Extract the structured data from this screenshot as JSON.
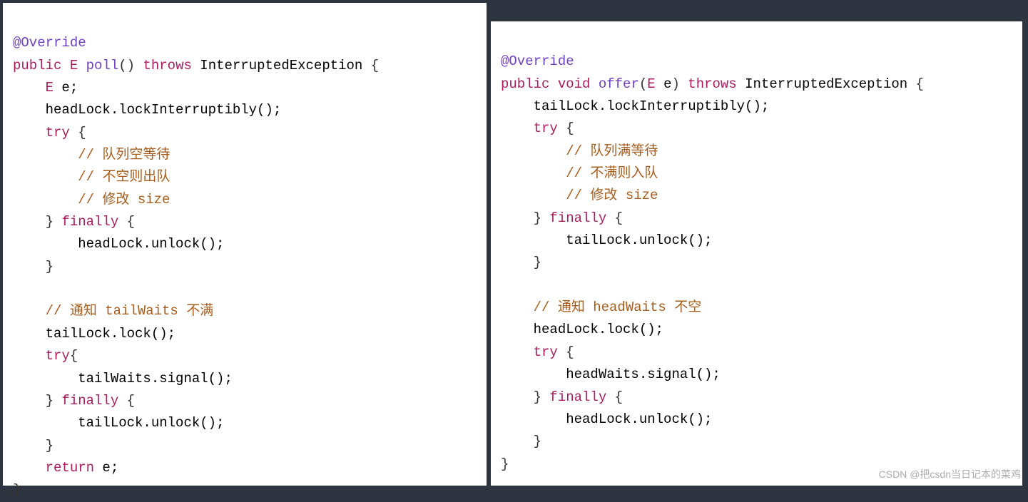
{
  "left": {
    "l1": "@Override",
    "l2_kw_public": "public",
    "l2_type_E": "E",
    "l2_mname": "poll",
    "l2_paren": "()",
    "l2_throws": "throws",
    "l2_ex": "InterruptedException",
    "l2_brace": " {",
    "l3_indent": "    ",
    "l3_type_E": "E",
    "l3_rest": " e;",
    "l4": "    headLock.lockInterruptibly();",
    "l5_indent": "    ",
    "l5_try": "try",
    "l5_brace": " {",
    "l6_indent": "        ",
    "l6_c": "// 队列空等待",
    "l7_indent": "        ",
    "l7_c": "// 不空则出队",
    "l8_indent": "        ",
    "l8_c": "// 修改 size",
    "l9_indent": "    } ",
    "l9_fin": "finally",
    "l9_brace": " {",
    "l10": "        headLock.unlock();",
    "l11": "    }",
    "l12": "",
    "l13_indent": "    ",
    "l13_c": "// 通知 tailWaits 不满",
    "l14": "    tailLock.lock();",
    "l15_indent": "    ",
    "l15_try": "try",
    "l15_brace": "{",
    "l16": "        tailWaits.signal();",
    "l17_indent": "    } ",
    "l17_fin": "finally",
    "l17_brace": " {",
    "l18": "        tailLock.unlock();",
    "l19": "    }",
    "l20_indent": "    ",
    "l20_ret": "return",
    "l20_rest": " e;",
    "l21": "}"
  },
  "right": {
    "l1": "@Override",
    "l2_kw_public": "public",
    "l2_void": "void",
    "l2_mname": "offer",
    "l2_popen": "(",
    "l2_ptype": "E",
    "l2_pname": " e",
    "l2_pclose": ")",
    "l2_throws": "throws",
    "l2_ex": "InterruptedException",
    "l2_brace": " {",
    "l3": "    tailLock.lockInterruptibly();",
    "l4_indent": "    ",
    "l4_try": "try",
    "l4_brace": " {",
    "l5_indent": "        ",
    "l5_c": "// 队列满等待",
    "l6_indent": "        ",
    "l6_c": "// 不满则入队",
    "l7_indent": "        ",
    "l7_c": "// 修改 size",
    "l8_indent": "    } ",
    "l8_fin": "finally",
    "l8_brace": " {",
    "l9": "        tailLock.unlock();",
    "l10": "    }",
    "l11": "",
    "l12_indent": "    ",
    "l12_c": "// 通知 headWaits 不空",
    "l13": "    headLock.lock();",
    "l14_indent": "    ",
    "l14_try": "try",
    "l14_brace": " {",
    "l15": "        headWaits.signal();",
    "l16_indent": "    } ",
    "l16_fin": "finally",
    "l16_brace": " {",
    "l17": "        headLock.unlock();",
    "l18": "    }",
    "l19": "}"
  },
  "watermark": "CSDN @把csdn当日记本的菜鸡"
}
